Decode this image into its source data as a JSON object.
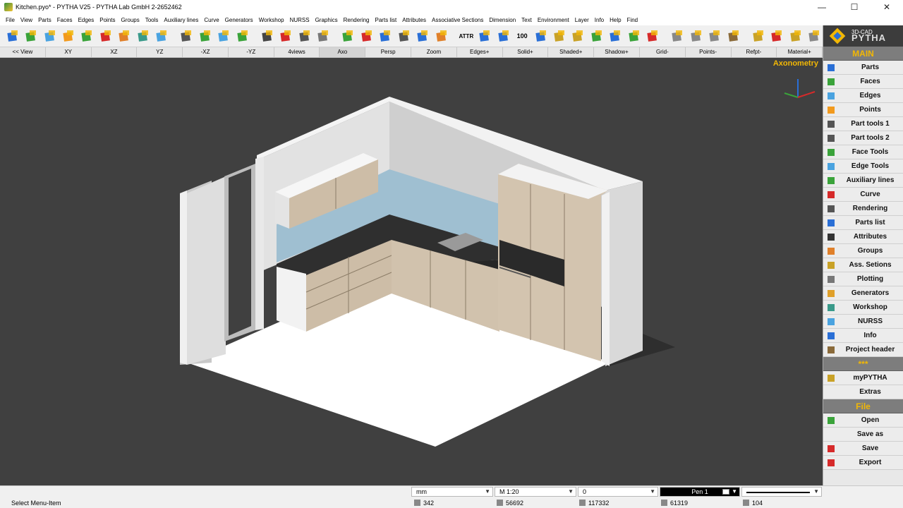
{
  "window": {
    "title": "Kitchen.pyo* - PYTHA V25 - PYTHA Lab GmbH 2-2652462",
    "minimize": "—",
    "maximize": "☐",
    "close": "✕"
  },
  "menu": [
    "File",
    "View",
    "Parts",
    "Faces",
    "Edges",
    "Points",
    "Groups",
    "Tools",
    "Auxiliary lines",
    "Curve",
    "Generators",
    "Workshop",
    "NURSS",
    "Graphics",
    "Rendering",
    "Parts list",
    "Attributes",
    "Associative Sections",
    "Dimension",
    "Text",
    "Environment",
    "Layer",
    "Info",
    "Help",
    "Find"
  ],
  "toolbar": {
    "icons": [
      "parts-icon",
      "faces-icon",
      "edges-icon",
      "points-icon",
      "auxiliary-lines-icon",
      "curve-icon",
      "generators-icon",
      "workshop-drill-icon",
      "nurss-icon",
      "part-tools-icon",
      "face-tools-icon",
      "edge-tools-icon",
      "aux-tools-icon",
      "camera-icon",
      "render-lights-icon",
      "eye-icon",
      "printer-icon",
      "export-up-icon",
      "import-down-icon",
      "undo-anchor-icon",
      "cup-icon",
      "undo-icon",
      "redo-icon",
      "attributes-icon",
      "parts-list-icon",
      "parts-list-2-icon",
      "counter-icon",
      "copy-icon",
      "texture-icon",
      "material-icon",
      "tree-icon",
      "info-icon",
      "refresh-icon",
      "delete-icon",
      "group-icon",
      "group-2-icon",
      "group-3-icon",
      "project-icon",
      "tool-icon",
      "pen-icon",
      "library-icon",
      "scissors-text-icon"
    ],
    "counter_label": "100",
    "attr_label": "ATTR"
  },
  "viewbar": {
    "items": [
      "<< View",
      "XY",
      "XZ",
      "YZ",
      "-XZ",
      "-YZ",
      "4views",
      "Axo",
      "Persp",
      "Zoom",
      "Edges+",
      "Solid+",
      "Shaded+",
      "Shadow+",
      "Grid-",
      "Points-",
      "Refpt-",
      "Material+"
    ],
    "active": "Axo"
  },
  "viewport": {
    "label": "Axonometry"
  },
  "panel": {
    "logo_small": "3D-CAD",
    "logo_big": "PYTHA",
    "main_header": "MAIN",
    "main_items": [
      {
        "label": "Parts",
        "icon": "parts-icon",
        "color": "#2a6fd6"
      },
      {
        "label": "Faces",
        "icon": "faces-icon",
        "color": "#3aa33a"
      },
      {
        "label": "Edges",
        "icon": "edges-icon",
        "color": "#4aa3e0"
      },
      {
        "label": "Points",
        "icon": "points-icon",
        "color": "#f29a1e"
      },
      {
        "label": "Part tools 1",
        "icon": "part-tools-1-icon",
        "color": "#555555"
      },
      {
        "label": "Part tools 2",
        "icon": "part-tools-2-icon",
        "color": "#555555"
      },
      {
        "label": "Face Tools",
        "icon": "face-tools-icon",
        "color": "#3aa33a"
      },
      {
        "label": "Edge Tools",
        "icon": "edge-tools-icon",
        "color": "#4aa3e0"
      },
      {
        "label": "Auxiliary lines",
        "icon": "auxiliary-lines-icon",
        "color": "#3aa33a"
      },
      {
        "label": "Curve",
        "icon": "curve-icon",
        "color": "#d62a2a"
      },
      {
        "label": "Rendering",
        "icon": "rendering-icon",
        "color": "#555555"
      },
      {
        "label": "Parts list",
        "icon": "parts-list-icon",
        "color": "#2a6fd6"
      },
      {
        "label": "Attributes",
        "icon": "attributes-icon",
        "color": "#333333"
      },
      {
        "label": "Groups",
        "icon": "groups-icon",
        "color": "#e0802a"
      },
      {
        "label": "Ass. Setions",
        "icon": "ass-sections-icon",
        "color": "#c9a227"
      },
      {
        "label": "Plotting",
        "icon": "plotting-icon",
        "color": "#777777"
      },
      {
        "label": "Generators",
        "icon": "generators-icon",
        "color": "#e0a02a"
      },
      {
        "label": "Workshop",
        "icon": "workshop-icon",
        "color": "#3a9a8a"
      },
      {
        "label": "NURSS",
        "icon": "nurss-icon",
        "color": "#4aa3e0"
      },
      {
        "label": "Info",
        "icon": "info-icon",
        "color": "#2a6fd6"
      },
      {
        "label": "Project header",
        "icon": "project-header-icon",
        "color": "#8a6a3a"
      }
    ],
    "stars_header": "***",
    "extra_items": [
      {
        "label": "myPYTHA",
        "icon": "mypytha-icon",
        "color": "#c9a227"
      },
      {
        "label": "Extras",
        "icon": "",
        "color": ""
      }
    ],
    "file_header": "File",
    "file_items": [
      {
        "label": "Open",
        "icon": "open-icon",
        "color": "#3aa33a"
      },
      {
        "label": "Save as",
        "icon": "",
        "color": ""
      },
      {
        "label": "Save",
        "icon": "save-icon",
        "color": "#d62a2a"
      },
      {
        "label": "Export",
        "icon": "export-icon",
        "color": "#d62a2a"
      }
    ]
  },
  "status": {
    "message": "Select Menu-Item",
    "unit": "mm",
    "scale": "M 1:20",
    "value": "0",
    "pen": "Pen 1",
    "counts": [
      {
        "icon": "parts-count-icon",
        "value": "342"
      },
      {
        "icon": "faces-count-icon",
        "value": "56692"
      },
      {
        "icon": "edges-count-icon",
        "value": "117332"
      },
      {
        "icon": "points-count-icon",
        "value": "61319"
      },
      {
        "icon": "materials-count-icon",
        "value": "104"
      }
    ]
  }
}
